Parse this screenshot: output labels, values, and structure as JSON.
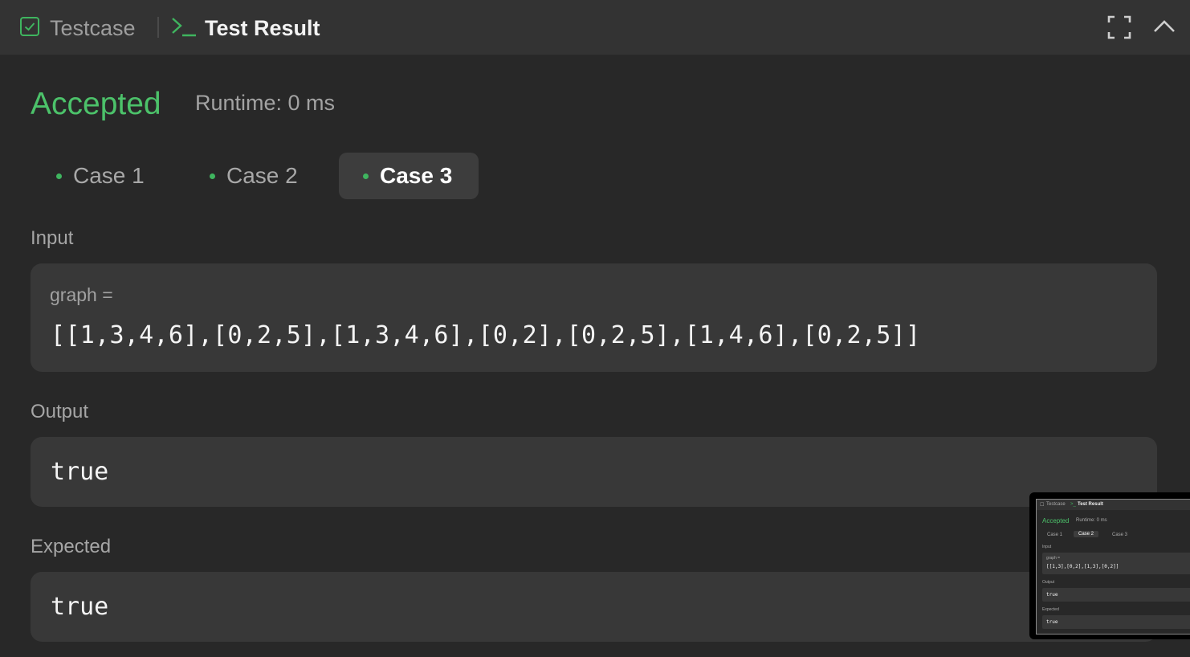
{
  "header": {
    "testcase_label": "Testcase",
    "result_label": "Test Result",
    "fullscreen_icon": "fullscreen-icon",
    "collapse_icon": "chevron-up-icon"
  },
  "result": {
    "status": "Accepted",
    "runtime": "Runtime: 0 ms"
  },
  "cases": [
    {
      "label": "Case 1",
      "active": false
    },
    {
      "label": "Case 2",
      "active": false
    },
    {
      "label": "Case 3",
      "active": true
    }
  ],
  "input": {
    "label": "Input",
    "var_name": "graph =",
    "value": "[[1,3,4,6],[0,2,5],[1,3,4,6],[0,2],[0,2,5],[1,4,6],[0,2,5]]"
  },
  "output": {
    "label": "Output",
    "value": "true"
  },
  "expected": {
    "label": "Expected",
    "value": "true"
  },
  "thumbnail": {
    "testcase_label": "Testcase",
    "result_label": "Test Result",
    "status": "Accepted",
    "runtime": "Runtime: 0 ms",
    "cases": [
      "Case 1",
      "Case 2",
      "Case 3"
    ],
    "input_label": "Input",
    "var_name": "graph =",
    "value": "[[1,3],[0,2],[1,3],[0,2]]",
    "output_label": "Output",
    "output_value": "true",
    "expected_label": "Expected",
    "expected_value": "true"
  },
  "colors": {
    "accepted": "#4cc26a",
    "background": "#282828",
    "panel": "#383838",
    "case_dot": "#3fb55f"
  }
}
